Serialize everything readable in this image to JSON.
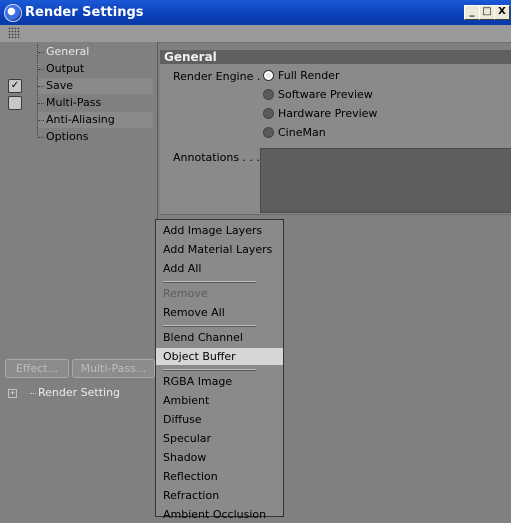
{
  "window": {
    "title": "Render Settings",
    "controls": {
      "minimize": "_",
      "maximize": "□",
      "close": "X"
    }
  },
  "tree": {
    "items": [
      {
        "label": "General",
        "selected": true
      },
      {
        "label": "Output"
      },
      {
        "label": "Save",
        "checkbox": true,
        "checked": true
      },
      {
        "label": "Multi-Pass",
        "checkbox": true,
        "checked": false
      },
      {
        "label": "Anti-Aliasing"
      },
      {
        "label": "Options"
      }
    ]
  },
  "left_buttons": {
    "effect": "Effect...",
    "multipass": "Multi-Pass..."
  },
  "render_setting_node": {
    "label": "Render Setting"
  },
  "section": {
    "header": "General",
    "render_engine_label": "Render Engine . .",
    "render_engines": [
      {
        "label": "Full Render",
        "selected": true
      },
      {
        "label": "Software Preview"
      },
      {
        "label": "Hardware Preview"
      },
      {
        "label": "CineMan"
      }
    ],
    "annotations_label": "Annotations . . . ."
  },
  "menu": {
    "items": [
      "Add Image Layers",
      "Add Material Layers",
      "Add All",
      "Remove",
      "Remove All",
      "Blend Channel",
      "Object Buffer",
      "RGBA Image",
      "Ambient",
      "Diffuse",
      "Specular",
      "Shadow",
      "Reflection",
      "Refraction",
      "Ambient Occlusion"
    ],
    "disabled": [
      "Remove"
    ],
    "highlighted": "Object Buffer"
  }
}
